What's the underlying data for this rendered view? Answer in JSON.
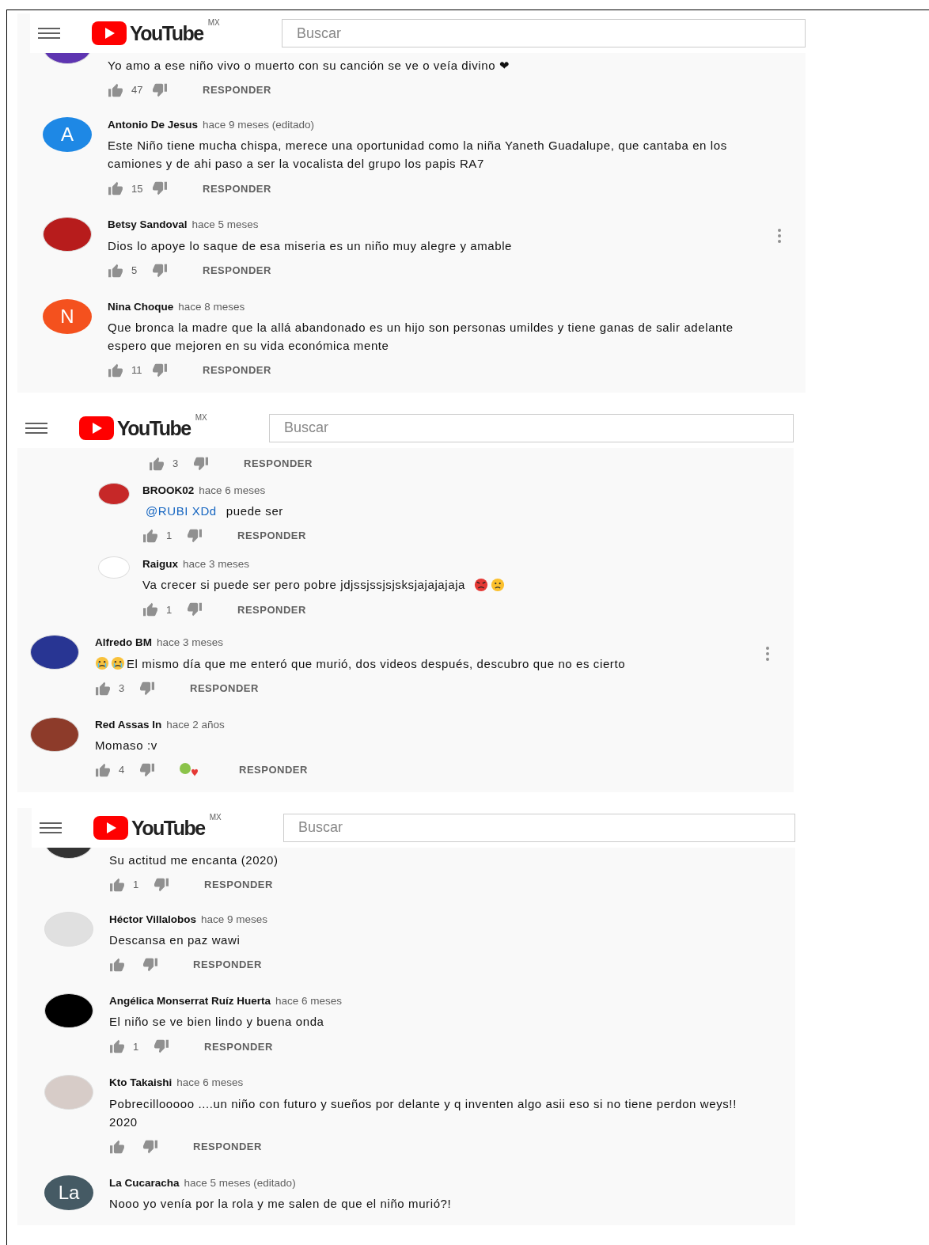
{
  "panels": [
    {
      "header": {
        "logo": "YouTube",
        "region": "MX",
        "search": {
          "placeholder": "Buscar"
        }
      },
      "comments": [
        {
          "kind": "partial",
          "avatar": {
            "kind": "photo",
            "color": "#5e35b1"
          },
          "body": "Yo amo a ese niño vivo o muerto  con su canción se ve o veía divino ❤",
          "likes": "47",
          "reply": "RESPONDER",
          "menu": false
        },
        {
          "kind": "full",
          "avatar": {
            "kind": "letter",
            "letter": "A",
            "color": "#1e88e5"
          },
          "author": "Antonio De Jesus",
          "time": "hace 9 meses (editado)",
          "body": "Este Niño tiene mucha chispa, merece una oportunidad como la niña Yaneth Guadalupe, que cantaba en los camiones y de ahi paso a ser la vocalista del grupo los papis RA7",
          "likes": "15",
          "reply": "RESPONDER",
          "menu": false
        },
        {
          "kind": "full",
          "avatar": {
            "kind": "photo",
            "color": "#b71c1c"
          },
          "author": "Betsy Sandoval",
          "time": "hace 5 meses",
          "body": "Dios lo apoye lo saque de esa miseria es un niño muy alegre y amable",
          "likes": "5",
          "reply": "RESPONDER",
          "menu": true
        },
        {
          "kind": "full",
          "avatar": {
            "kind": "letter",
            "letter": "N",
            "color": "#f4511e"
          },
          "author": "Nina Choque",
          "time": "hace 8 meses",
          "body": "Que bronca la madre que la allá abandonado es un hijo  son personas umildes  y tiene ganas de salir adelante espero que mejoren en su vida económica mente",
          "likes": "11",
          "reply": "RESPONDER",
          "menu": false
        }
      ]
    },
    {
      "header": {
        "logo": "YouTube",
        "region": "MX",
        "search": {
          "placeholder": "Buscar"
        }
      },
      "comments": [
        {
          "kind": "actions",
          "reply_level": true,
          "likes": "3",
          "reply": "RESPONDER",
          "menu": false
        },
        {
          "kind": "full",
          "reply_level": true,
          "avatar": {
            "kind": "photo",
            "color": "#c62828"
          },
          "author": "BROOK02",
          "time": "hace 6 meses",
          "mention": "@RUBI XDd",
          "body": "puede ser",
          "likes": "1",
          "reply": "RESPONDER",
          "menu": false
        },
        {
          "kind": "full",
          "reply_level": true,
          "avatar": {
            "kind": "photo",
            "color": "#ffffff"
          },
          "author": "Raigux",
          "time": "hace 3 meses",
          "body": "Va crecer si puede ser pero pobre jdjssjssjsjsksjajajajaja",
          "trailing_emoji": true,
          "likes": "1",
          "reply": "RESPONDER",
          "menu": false
        },
        {
          "kind": "full",
          "reply_level": false,
          "avatar": {
            "kind": "photo",
            "color": "#283593"
          },
          "author": "Alfredo BM",
          "time": "hace 3 meses",
          "body": "El mismo día que me enteró que murió, dos videos después, descubro que no es cierto",
          "leading_emoji": true,
          "likes": "3",
          "reply": "RESPONDER",
          "menu": true
        },
        {
          "kind": "full",
          "reply_level": false,
          "avatar": {
            "kind": "photo",
            "color": "#8d3b2a"
          },
          "author": "Red Assas In",
          "time": "hace 2 años",
          "body": "Momaso :v",
          "likes": "4",
          "hearted": true,
          "reply": "RESPONDER",
          "menu": false
        }
      ]
    },
    {
      "header": {
        "logo": "YouTube",
        "region": "MX",
        "search": {
          "placeholder": "Buscar"
        }
      },
      "comments": [
        {
          "kind": "partial",
          "avatar": {
            "kind": "photo",
            "color": "#333333"
          },
          "body": "Su actitud me encanta (2020)",
          "likes": "1",
          "reply": "RESPONDER",
          "menu": false
        },
        {
          "kind": "full",
          "avatar": {
            "kind": "photo",
            "color": "#e0e0e0"
          },
          "author": "Héctor Villalobos",
          "time": "hace 9 meses",
          "body": "Descansa en paz wawi",
          "reply": "RESPONDER",
          "menu": false
        },
        {
          "kind": "full",
          "avatar": {
            "kind": "photo",
            "color": "#000000"
          },
          "author": "Angélica Monserrat Ruíz Huerta",
          "time": "hace 6 meses",
          "body": "El niño se ve bien lindo y buena onda",
          "likes": "1",
          "reply": "RESPONDER",
          "menu": false
        },
        {
          "kind": "full",
          "avatar": {
            "kind": "photo",
            "color": "#d7ccc8"
          },
          "author": "Kto Takaishi",
          "time": "hace 6 meses",
          "body": "Pobrecillooooo ....un niño con futuro y sueños por delante y q inventen algo asii eso si no tiene perdon weys!! 2020",
          "reply": "RESPONDER",
          "menu": false
        },
        {
          "kind": "full",
          "avatar": {
            "kind": "letter",
            "letter": "La",
            "color": "#455a64"
          },
          "author": "La Cucaracha",
          "time": "hace 5 meses (editado)",
          "body": "Nooo yo venía por la rola y me salen de que el niño murió?!",
          "menu": false,
          "no_actions": true
        }
      ]
    }
  ]
}
